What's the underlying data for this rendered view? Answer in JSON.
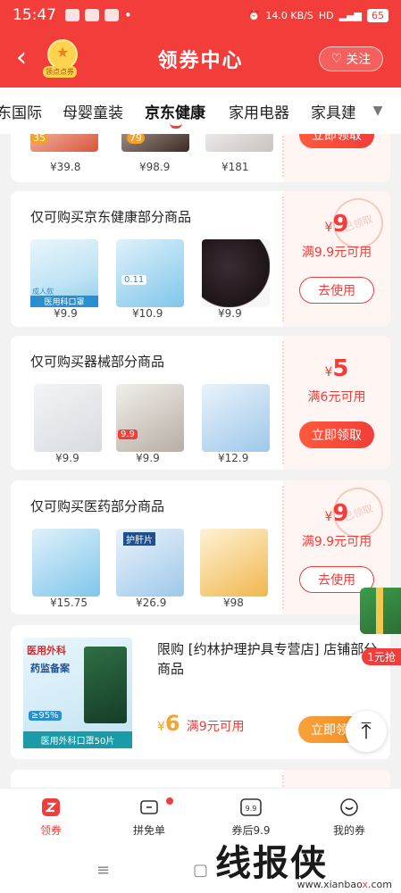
{
  "status": {
    "time": "15:47",
    "net_speed": "14.0 KB/S",
    "battery": "65",
    "hd": "HD"
  },
  "header": {
    "back_icon": "chevron-left-icon",
    "title": "领券中心",
    "sign_label": "领点点券",
    "follow_label": "关注"
  },
  "categories": [
    {
      "label": "东国际",
      "active": false
    },
    {
      "label": "母婴童装",
      "active": false
    },
    {
      "label": "京东健康",
      "active": true
    },
    {
      "label": "家用电器",
      "active": false
    },
    {
      "label": "家具建",
      "active": false
    }
  ],
  "partial_card": {
    "prices": [
      "¥39.8",
      "¥98.9",
      "¥181"
    ],
    "badges": [
      "35",
      "79"
    ],
    "button": "立即领取"
  },
  "coupons": [
    {
      "title": "仅可购买京东健康部分商品",
      "products": [
        {
          "price": "¥9.9",
          "label": "医用科口罩",
          "tag": "成人款"
        },
        {
          "price": "¥10.9",
          "label": "0.11"
        },
        {
          "price": "¥9.9"
        }
      ],
      "amount_symbol": "¥",
      "amount": "9",
      "condition": "满9.9元可用",
      "button": "去使用",
      "stamp": "已领取"
    },
    {
      "title": "仅可购买器械部分商品",
      "products": [
        {
          "price": "¥9.9"
        },
        {
          "price": "¥9.9",
          "label": "9.9"
        },
        {
          "price": "¥12.9"
        }
      ],
      "amount_symbol": "¥",
      "amount": "5",
      "condition": "满6元可用",
      "button": "立即领取"
    },
    {
      "title": "仅可购买医药部分商品",
      "products": [
        {
          "price": "¥15.75"
        },
        {
          "price": "¥26.9",
          "label": "护肝片"
        },
        {
          "price": "¥98"
        }
      ],
      "amount_symbol": "¥",
      "amount": "9",
      "condition": "满9.9元可用",
      "button": "去使用",
      "stamp": "已领取"
    }
  ],
  "store_card": {
    "image_title": "医用外科",
    "image_sub": "药监备案",
    "image_percent": "≥95%",
    "image_footer": "医用外科口罩50片",
    "title": "限购 [约林护理护具专营店] 店铺部分商品",
    "amount_symbol": "¥",
    "amount": "6",
    "condition": "满9元可用",
    "button": "立即领"
  },
  "float_gift": {
    "label": "1元抢"
  },
  "tabbar": [
    {
      "label": "领券",
      "icon": "coupon-icon",
      "active": true
    },
    {
      "label": "拼免单",
      "icon": "ticket-icon",
      "active": false
    },
    {
      "label": "券后9.9",
      "icon": "price-tag-icon",
      "active": false
    },
    {
      "label": "我的券",
      "icon": "smile-icon",
      "active": false
    }
  ],
  "watermark": {
    "text": "线报侠",
    "url_pre": "www.xianbao",
    "url_x": "x",
    "url_post": ".com"
  },
  "colors": {
    "brand": "#f23d3a",
    "accent_bg": "#fff5f2"
  }
}
